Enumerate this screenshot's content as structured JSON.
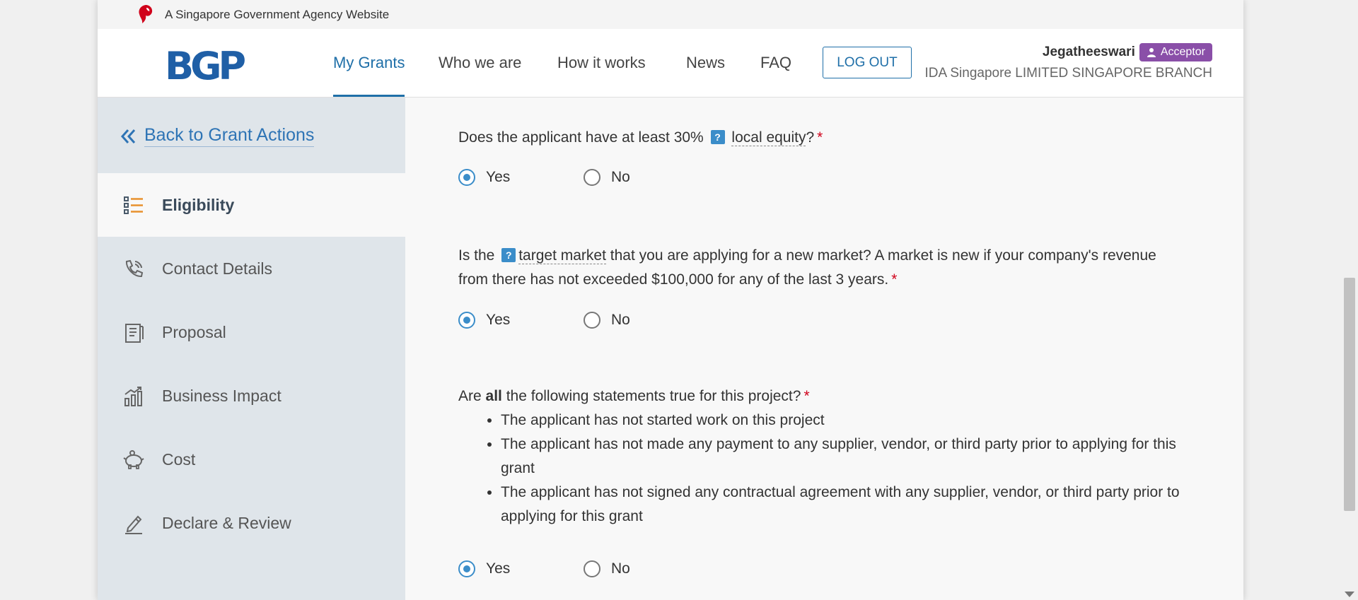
{
  "masthead": {
    "text": "A Singapore Government Agency Website"
  },
  "header": {
    "logo": "BGP",
    "nav": [
      "My Grants",
      "Who we are",
      "How it works",
      "News",
      "FAQ"
    ],
    "logout_label": "LOG OUT",
    "user_name": "Jegatheeswari",
    "role": "Acceptor",
    "org": "IDA Singapore LIMITED SINGAPORE BRANCH"
  },
  "sidebar": {
    "back_label": "Back to Grant Actions",
    "items": [
      {
        "label": "Eligibility",
        "icon": "list-icon",
        "active": true
      },
      {
        "label": "Contact Details",
        "icon": "phone-icon"
      },
      {
        "label": "Proposal",
        "icon": "document-icon"
      },
      {
        "label": "Business Impact",
        "icon": "chart-icon"
      },
      {
        "label": "Cost",
        "icon": "piggy-bank-icon"
      },
      {
        "label": "Declare & Review",
        "icon": "pen-icon"
      }
    ]
  },
  "questions": {
    "q1": {
      "pre": "Does the applicant have at least 30%",
      "term": "local equity",
      "post": "?"
    },
    "q2": {
      "pre": "Is the",
      "term": "target market",
      "post": " that you are applying for a new market? A market is new if your company's revenue from there has not exceeded $100,000 for any of the last 3 years."
    },
    "q3": {
      "pre": "Are",
      "bold": "all",
      "post": " the following statements true for this project?",
      "statements": [
        "The applicant has not started work on this project",
        "The applicant has not made any payment to any supplier, vendor, or third party prior to applying for this grant",
        "The applicant has not signed any contractual agreement with any supplier, vendor, or third party prior to applying for this grant"
      ]
    },
    "required_mark": "*",
    "help_mark": "?",
    "yes_label": "Yes",
    "no_label": "No",
    "selected": [
      "Yes",
      "Yes",
      "Yes"
    ]
  },
  "colors": {
    "primary": "#1f6fa8",
    "role_badge": "#8a4fa8",
    "required": "#d0021b"
  }
}
